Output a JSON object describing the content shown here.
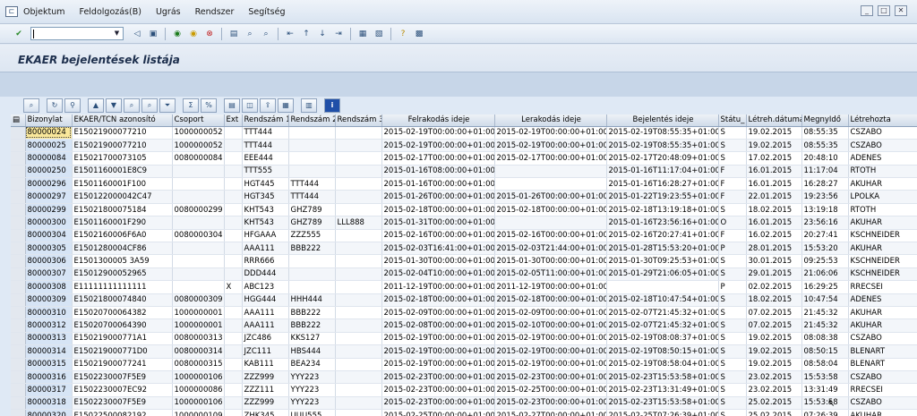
{
  "menubar": {
    "items": [
      "Objektum",
      "Feldolgozás(B)",
      "Ugrás",
      "Rendszer",
      "Segítség"
    ]
  },
  "toolbar": {
    "command_value": ""
  },
  "screen": {
    "title": "EKAER bejelentések listája"
  },
  "table": {
    "columns": [
      "Bizonylat",
      "EKAER/TCN azonosító",
      "Csoport",
      "Ext",
      "Rendszám 1",
      "Rendszám 2",
      "Rendszám 3",
      "Felrakodás ideje",
      "Lerakodás ideje",
      "Bejelentés ideje",
      "Státu_",
      "Létreh.dátuma",
      "MegnyIdő",
      "Létrehozta"
    ],
    "rows": [
      [
        "80000024",
        "E15021900077210",
        "1000000052",
        "",
        "TTT444",
        "",
        "",
        "2015-02-19T00:00:00+01:00",
        "2015-02-19T00:00:00+01:00",
        "2015-02-19T08:55:35+01:00",
        "S",
        "19.02.2015",
        "08:55:35",
        "CSZABO"
      ],
      [
        "80000025",
        "E15021900077210",
        "1000000052",
        "",
        "TTT444",
        "",
        "",
        "2015-02-19T00:00:00+01:00",
        "2015-02-19T00:00:00+01:00",
        "2015-02-19T08:55:35+01:00",
        "S",
        "19.02.2015",
        "08:55:35",
        "CSZABO"
      ],
      [
        "80000084",
        "E15021700073105",
        "0080000084",
        "",
        "EEE444",
        "",
        "",
        "2015-02-17T00:00:00+01:00",
        "2015-02-17T00:00:00+01:00",
        "2015-02-17T20:48:09+01:00",
        "S",
        "17.02.2015",
        "20:48:10",
        "ADENES"
      ],
      [
        "80000250",
        "E1501160001E8C9",
        "",
        "",
        "TTT555",
        "",
        "",
        "2015-01-16T08:00:00+01:00",
        "",
        "2015-01-16T11:17:04+01:00",
        "F",
        "16.01.2015",
        "11:17:04",
        "RTOTH"
      ],
      [
        "80000296",
        "E1501160001F100",
        "",
        "",
        "HGT445",
        "TTT444",
        "",
        "2015-01-16T00:00:00+01:00",
        "",
        "2015-01-16T16:28:27+01:00",
        "F",
        "16.01.2015",
        "16:28:27",
        "AKUHAR"
      ],
      [
        "80000297",
        "E150122000042C47",
        "",
        "",
        "HGT345",
        "TTT444",
        "",
        "2015-01-26T00:00:00+01:00",
        "2015-01-26T00:00:00+01:00",
        "2015-01-22T19:23:55+01:00",
        "F",
        "22.01.2015",
        "19:23:56",
        "LPOLKA"
      ],
      [
        "80000299",
        "E15021800075184",
        "0080000299",
        "",
        "KHT543",
        "GHZ789",
        "",
        "2015-02-18T00:00:00+01:00",
        "2015-02-18T00:00:00+01:00",
        "2015-02-18T13:19:18+01:00",
        "S",
        "18.02.2015",
        "13:19:18",
        "RTOTH"
      ],
      [
        "80000300",
        "E1501160001F290",
        "",
        "",
        "KHT543",
        "GHZ789",
        "LLL888",
        "2015-01-31T00:00:00+01:00",
        "",
        "2015-01-16T23:56:16+01:00",
        "O",
        "16.01.2015",
        "23:56:16",
        "AKUHAR"
      ],
      [
        "80000304",
        "E1502160006F6A0",
        "0080000304",
        "",
        "HFGAAA",
        "ZZZ555",
        "",
        "2015-02-16T00:00:00+01:00",
        "2015-02-16T00:00:00+01:00",
        "2015-02-16T20:27:41+01:00",
        "F",
        "16.02.2015",
        "20:27:41",
        "KSCHNEIDER"
      ],
      [
        "80000305",
        "E1501280004CF86",
        "",
        "",
        "AAA111",
        "BBB222",
        "",
        "2015-02-03T16:41:00+01:00",
        "2015-02-03T21:44:00+01:00",
        "2015-01-28T15:53:20+01:00",
        "P",
        "28.01.2015",
        "15:53:20",
        "AKUHAR"
      ],
      [
        "80000306",
        "E1501300005 3A59",
        "",
        "",
        "RRR666",
        "",
        "",
        "2015-01-30T00:00:00+01:00",
        "2015-01-30T00:00:00+01:00",
        "2015-01-30T09:25:53+01:00",
        "S",
        "30.01.2015",
        "09:25:53",
        "KSCHNEIDER"
      ],
      [
        "80000307",
        "E15012900052965",
        "",
        "",
        "DDD444",
        "",
        "",
        "2015-02-04T10:00:00+01:00",
        "2015-02-05T11:00:00+01:00",
        "2015-01-29T21:06:05+01:00",
        "S",
        "29.01.2015",
        "21:06:06",
        "KSCHNEIDER"
      ],
      [
        "80000308",
        "E11111111111111",
        "",
        "X",
        "ABC123",
        "",
        "",
        "2011-12-19T00:00:00+01:00",
        "2011-12-19T00:00:00+01:00",
        "",
        "P",
        "02.02.2015",
        "16:29:25",
        "RRECSEI"
      ],
      [
        "80000309",
        "E15021800074840",
        "0080000309",
        "",
        "HGG444",
        "HHH444",
        "",
        "2015-02-18T00:00:00+01:00",
        "2015-02-18T00:00:00+01:00",
        "2015-02-18T10:47:54+01:00",
        "S",
        "18.02.2015",
        "10:47:54",
        "ADENES"
      ],
      [
        "80000310",
        "E15020700064382",
        "1000000001",
        "",
        "AAA111",
        "BBB222",
        "",
        "2015-02-09T00:00:00+01:00",
        "2015-02-09T00:00:00+01:00",
        "2015-02-07T21:45:32+01:00",
        "S",
        "07.02.2015",
        "21:45:32",
        "AKUHAR"
      ],
      [
        "80000312",
        "E15020700064390",
        "1000000001",
        "",
        "AAA111",
        "BBB222",
        "",
        "2015-02-08T00:00:00+01:00",
        "2015-02-10T00:00:00+01:00",
        "2015-02-07T21:45:32+01:00",
        "S",
        "07.02.2015",
        "21:45:32",
        "AKUHAR"
      ],
      [
        "80000313",
        "E150219000771A1",
        "0080000313",
        "",
        "JZC486",
        "KKS127",
        "",
        "2015-02-19T00:00:00+01:00",
        "2015-02-19T00:00:00+01:00",
        "2015-02-19T08:08:37+01:00",
        "S",
        "19.02.2015",
        "08:08:38",
        "CSZABO"
      ],
      [
        "80000314",
        "E150219000771D0",
        "0080000314",
        "",
        "JZC111",
        "HBS444",
        "",
        "2015-02-19T00:00:00+01:00",
        "2015-02-19T00:00:00+01:00",
        "2015-02-19T08:50:15+01:00",
        "S",
        "19.02.2015",
        "08:50:15",
        "BLENART"
      ],
      [
        "80000315",
        "E15021900077241",
        "0080000315",
        "",
        "KAB111",
        "BEA234",
        "",
        "2015-02-19T00:00:00+01:00",
        "2015-02-19T00:00:00+01:00",
        "2015-02-19T08:58:04+01:00",
        "S",
        "19.02.2015",
        "08:58:04",
        "BLENART"
      ],
      [
        "80000316",
        "E1502230007F5E9",
        "1000000106",
        "",
        "ZZZ999",
        "YYY223",
        "",
        "2015-02-23T00:00:00+01:00",
        "2015-02-23T00:00:00+01:00",
        "2015-02-23T15:53:58+01:00",
        "S",
        "23.02.2015",
        "15:53:58",
        "CSZABO"
      ],
      [
        "80000317",
        "E1502230007EC92",
        "1000000086",
        "",
        "ZZZ111",
        "YYY223",
        "",
        "2015-02-23T00:00:00+01:00",
        "2015-02-25T00:00:00+01:00",
        "2015-02-23T13:31:49+01:00",
        "S",
        "23.02.2015",
        "13:31:49",
        "RRECSEI"
      ],
      [
        "80000318",
        "E1502230007F5E9",
        "1000000106",
        "",
        "ZZZ999",
        "YYY223",
        "",
        "2015-02-23T00:00:00+01:00",
        "2015-02-23T00:00:00+01:00",
        "2015-02-23T15:53:58+01:00",
        "S",
        "25.02.2015",
        "15:53:58",
        "CSZABO"
      ],
      [
        "80000320",
        "E15022500082192",
        "1000000109",
        "",
        "ZHK345",
        "UUU555",
        "",
        "2015-02-25T00:00:00+01:00",
        "2015-02-27T00:00:00+01:00",
        "2015-02-25T07:26:39+01:00",
        "S",
        "25.02.2015",
        "07:26:39",
        "AKUHAR"
      ]
    ]
  },
  "colors": {
    "accent": "#1d2f4d",
    "key_cell": "#d6e4f5",
    "focus_cell": "#f9e79a"
  }
}
